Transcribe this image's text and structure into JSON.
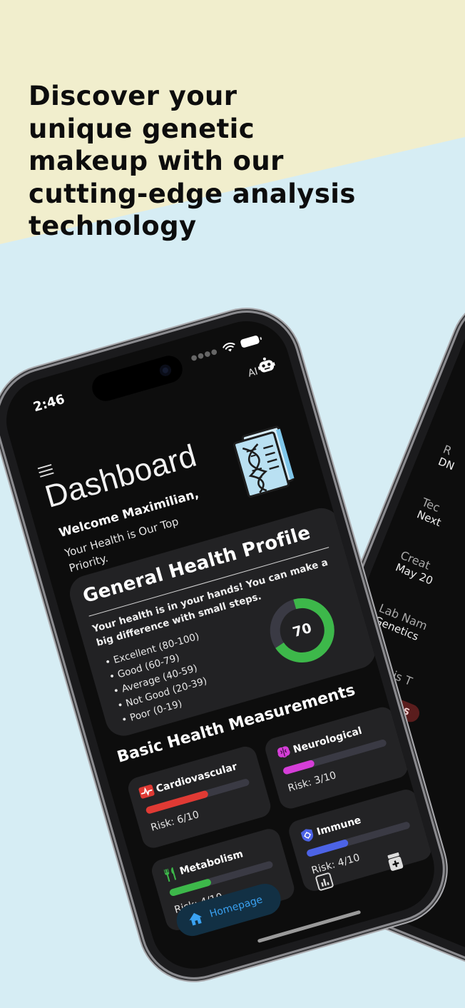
{
  "headline": {
    "lines": [
      "Discover your",
      "unique genetic",
      "makeup with our",
      "cutting-edge analysis",
      "technology"
    ]
  },
  "colors": {
    "top_band": "#f1eecd",
    "background": "#d6edf4",
    "screen_bg": "#0d0d0d",
    "card_bg": "#222224",
    "gauge_green": "#3db84a",
    "accent_blue": "#3aa2f2"
  },
  "phone": {
    "status": {
      "time": "2:46"
    },
    "header": {
      "ai_label": "AI",
      "bot_icon": "robot-icon",
      "menu_icon": "hamburger-menu-icon"
    },
    "title": "Dashboard",
    "welcome": "Welcome Maximilian,",
    "tagline": "Your Health is Our Top Priority.",
    "profile": {
      "title": "General Health Profile",
      "subtitle": "Your health is in your hands! You can make a big difference with small steps.",
      "scale": [
        "Excellent (80-100)",
        "Good (60-79)",
        "Average (40-59)",
        "Not Good (20-39)",
        "Poor (0-19)"
      ],
      "score": "70",
      "score_fraction": 0.7
    },
    "measurements": {
      "title": "Basic Health Measurements",
      "items": [
        {
          "name": "Cardiovascular",
          "risk": "Risk: 6/10",
          "level": 0.6,
          "color": "#e03a34",
          "icon": "heart-monitor-icon"
        },
        {
          "name": "Neurological",
          "risk": "Risk: 3/10",
          "level": 0.3,
          "color": "#d53ed8",
          "icon": "brain-icon"
        },
        {
          "name": "Metabolism",
          "risk": "Risk: 4/10",
          "level": 0.4,
          "color": "#3db84a",
          "icon": "fork-knife-icon"
        },
        {
          "name": "Immune",
          "risk": "Risk: 4/10",
          "level": 0.4,
          "color": "#4c63e6",
          "icon": "shield-virus-icon"
        }
      ]
    },
    "nav": {
      "home_label": "Homepage",
      "items": [
        "home-icon",
        "chart-icon",
        "medicine-icon"
      ]
    }
  },
  "phone2": {
    "rows": [
      {
        "label": "R",
        "value": "DN"
      },
      {
        "label": "Tec",
        "value": "Next"
      },
      {
        "label": "Creat",
        "value": "May 20"
      },
      {
        "label": "Lab Nam",
        "value": "Genetics"
      },
      {
        "label": "Analysis T",
        "value": ""
      }
    ],
    "badge": "HEALTH RIS",
    "nav_icon": "home-icon"
  }
}
